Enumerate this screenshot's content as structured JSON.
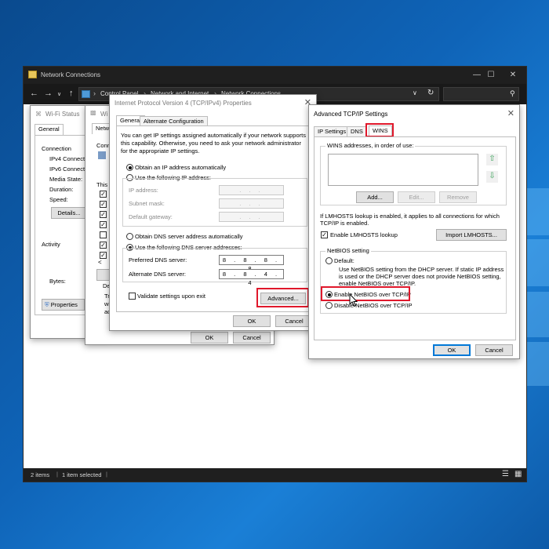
{
  "explorer": {
    "title": "Network Connections",
    "breadcrumbs": [
      "Control Panel",
      "Network and Internet",
      "Network Connections"
    ],
    "status_items": "2 items",
    "status_selected": "1 item selected"
  },
  "wifi_status": {
    "title": "Wi-Fi Status",
    "tab_general": "General",
    "section_connection": "Connection",
    "rows": [
      "IPv4 Connectivity:",
      "IPv6 Connectivity:",
      "Media State:",
      "Duration:",
      "Speed:"
    ],
    "details_button": "Details...",
    "section_activity": "Activity",
    "bytes_label": "Bytes:",
    "properties_button": "Properties"
  },
  "wifi_props": {
    "title": "Wi",
    "tab": "Netwo",
    "connect_label": "Conn",
    "this_label": "This",
    "desc_label": "De",
    "desc_text": [
      "Tra",
      "wi",
      "ac"
    ],
    "ok": "OK",
    "cancel": "Cancel"
  },
  "ipv4": {
    "title": "Internet Protocol Version 4 (TCP/IPv4) Properties",
    "tabs": [
      "General",
      "Alternate Configuration"
    ],
    "intro": [
      "You can get IP settings assigned automatically if your network supports",
      "this capability. Otherwise, you need to ask your network administrator",
      "for the appropriate IP settings."
    ],
    "obtain_ip_auto": "Obtain an IP address automatically",
    "use_following_ip": "Use the following IP address:",
    "ip_address_label": "IP address:",
    "subnet_label": "Subnet mask:",
    "gateway_label": "Default gateway:",
    "empty_ip": ". . .",
    "obtain_dns_auto": "Obtain DNS server address automatically",
    "use_following_dns": "Use the following DNS server addresses:",
    "preferred_dns_label": "Preferred DNS server:",
    "preferred_dns_value": "8 . 8 . 8 . 8",
    "alternate_dns_label": "Alternate DNS server:",
    "alternate_dns_value": "8 . 8 . 4 . 4",
    "validate_label": "Validate settings upon exit",
    "advanced_button": "Advanced...",
    "ok": "OK",
    "cancel": "Cancel"
  },
  "advanced": {
    "title": "Advanced TCP/IP Settings",
    "tabs": [
      "IP Settings",
      "DNS",
      "WINS"
    ],
    "wins_list_label": "WINS addresses, in order of use:",
    "add_button": "Add...",
    "edit_button": "Edit...",
    "remove_button": "Remove",
    "lmhosts_info": [
      "If LMHOSTS lookup is enabled, it applies to all connections for which",
      "TCP/IP is enabled."
    ],
    "enable_lmhosts": "Enable LMHOSTS lookup",
    "import_button": "Import LMHOSTS...",
    "netbios_group": "NetBIOS setting",
    "default_label": "Default:",
    "default_desc": [
      "Use NetBIOS setting from the DHCP server. If static IP address",
      "is used or the DHCP server does not provide NetBIOS setting,",
      "enable NetBIOS over TCP/IP."
    ],
    "enable_netbios": "Enable NetBIOS over TCP/IP",
    "disable_netbios": "Disable NetBIOS over TCP/IP",
    "ok": "OK",
    "cancel": "Cancel"
  },
  "colors": {
    "highlight": "#e0182b",
    "accent": "#0078d7"
  }
}
